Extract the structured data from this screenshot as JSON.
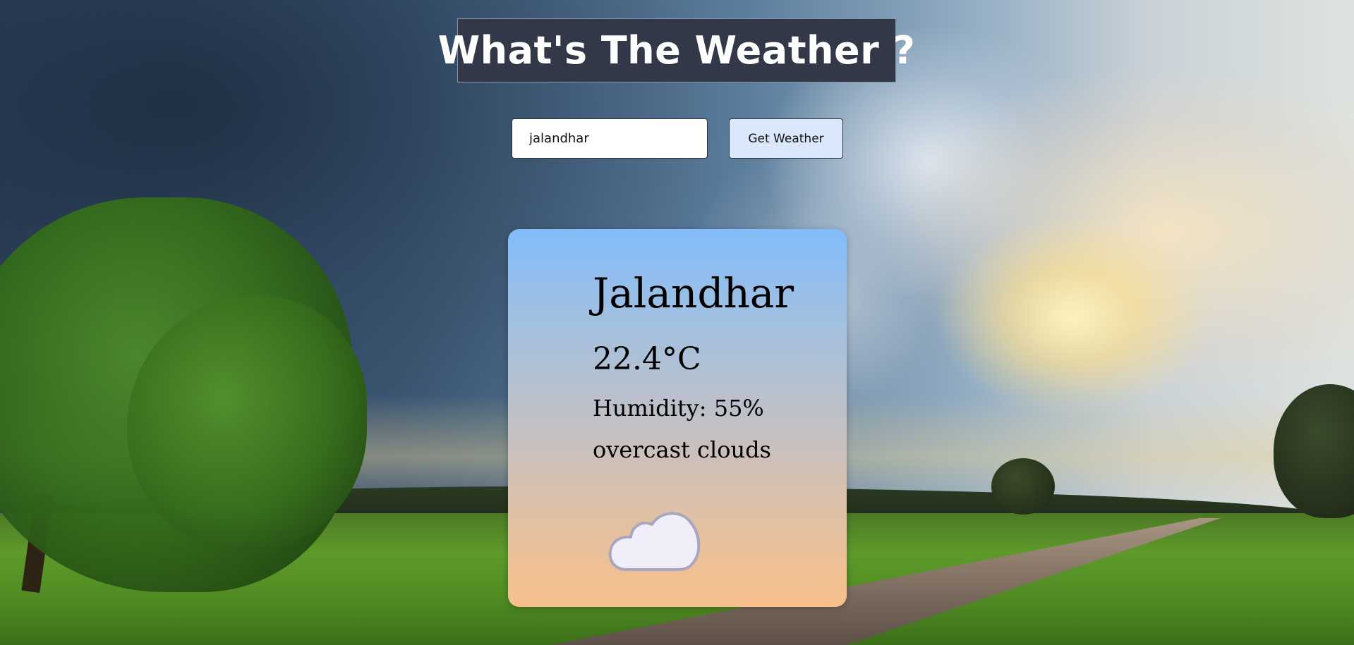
{
  "header": {
    "title": "What's The Weather ?"
  },
  "search": {
    "value": "jalandhar",
    "button_label": "Get Weather"
  },
  "weather": {
    "city": "Jalandhar",
    "temperature": "22.4°C",
    "humidity": "Humidity: 55%",
    "description": "overcast clouds",
    "icon": "overcast-cloud-icon"
  },
  "colors": {
    "title_bg": "#323848",
    "button_bg": "#dbe8fb",
    "card_top": "#82bdfa",
    "card_bottom": "#f8c08c",
    "cloud_fill": "#f0eef8",
    "cloud_stroke": "#a9a6bd"
  }
}
